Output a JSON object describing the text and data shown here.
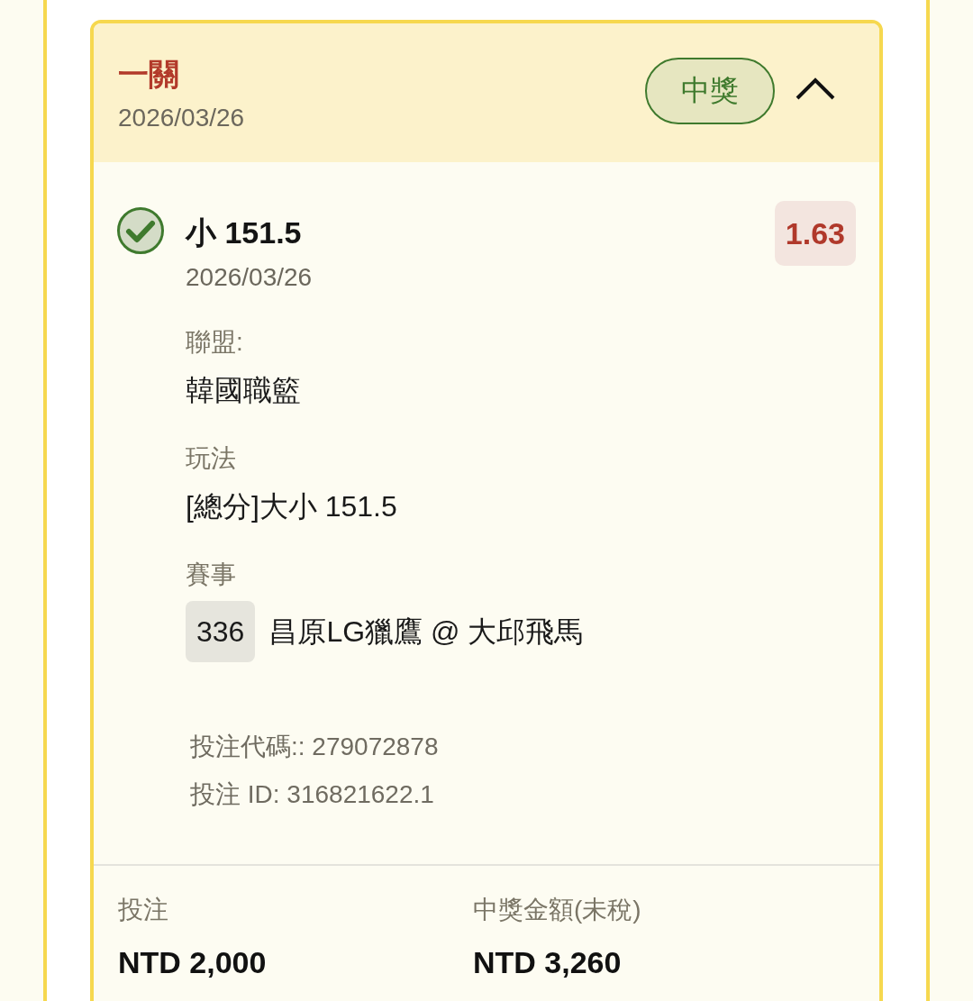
{
  "bet": {
    "type_label": "一關",
    "date": "2026/03/26",
    "status": {
      "label": "中獎",
      "kind": "won"
    },
    "expanded": true,
    "selection": {
      "won": true,
      "pick": "小 151.5",
      "date": "2026/03/26",
      "odds": "1.63"
    },
    "details": [
      {
        "kind": "text",
        "label": "聯盟:",
        "value": "韓國職籃"
      },
      {
        "kind": "text",
        "label": "玩法",
        "value": "[總分]大小 151.5"
      },
      {
        "kind": "match",
        "label": "賽事",
        "match_number": "336",
        "value": "昌原LG獵鷹 @ 大邱飛馬"
      }
    ],
    "codes": [
      "投注代碼:: 279072878",
      "投注 ID: 316821622.1"
    ],
    "summary": [
      {
        "label": "投注",
        "value": "NTD 2,000"
      },
      {
        "label": "中獎金額(未稅)",
        "value": "NTD 3,260"
      }
    ]
  }
}
